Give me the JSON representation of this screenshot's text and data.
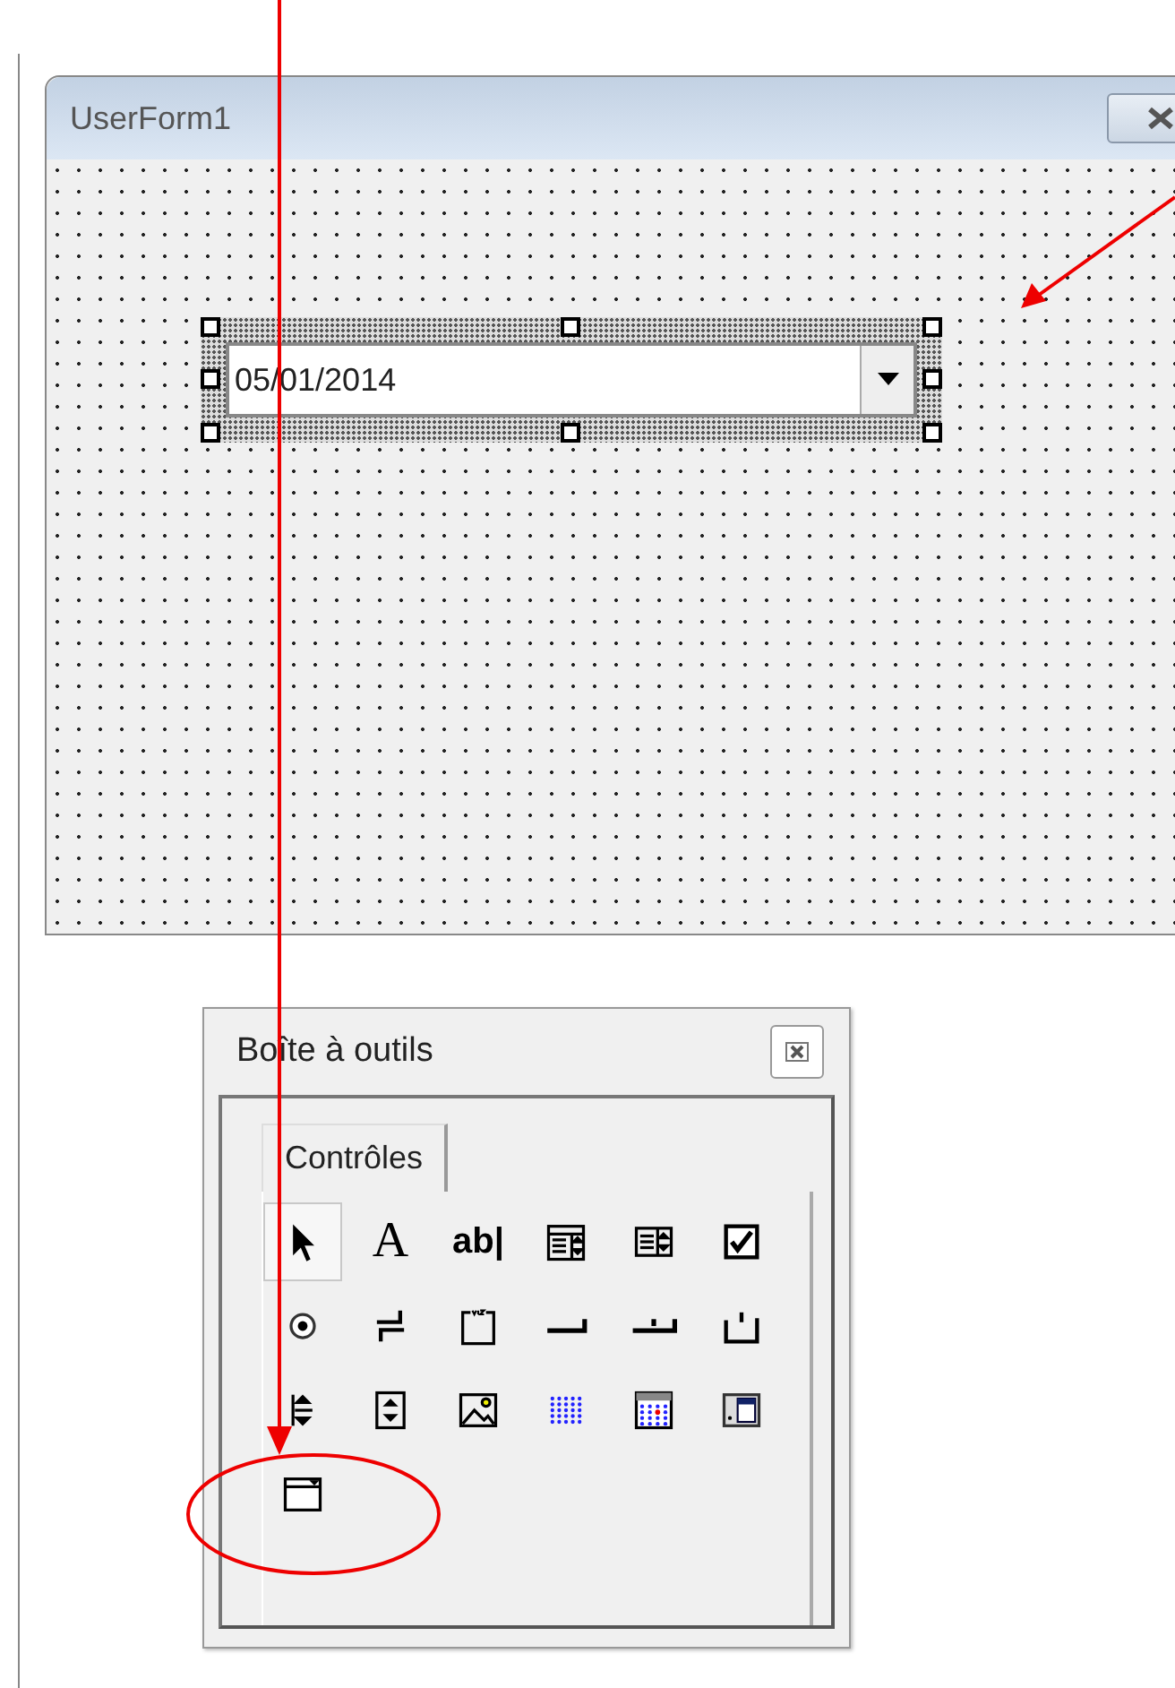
{
  "form": {
    "title": "UserForm1",
    "combo": {
      "value": "05/01/2014",
      "selected": true
    }
  },
  "toolbox": {
    "title": "Boîte à outils",
    "tabs": [
      {
        "label": "Contrôles",
        "selected": true
      }
    ],
    "tools": [
      {
        "kind": "pointer",
        "selected": true
      },
      {
        "kind": "label",
        "glyph": "A",
        "selected": false
      },
      {
        "kind": "textbox",
        "glyph": "ab|",
        "selected": false
      },
      {
        "kind": "combobox",
        "selected": false
      },
      {
        "kind": "listbox",
        "selected": false
      },
      {
        "kind": "checkbox",
        "selected": false
      },
      {
        "kind": "option",
        "selected": false
      },
      {
        "kind": "toggle",
        "selected": false
      },
      {
        "kind": "frame",
        "selected": false
      },
      {
        "kind": "command",
        "selected": false
      },
      {
        "kind": "tabstrip",
        "selected": false
      },
      {
        "kind": "multipage",
        "selected": false
      },
      {
        "kind": "scrollbar",
        "selected": false
      },
      {
        "kind": "spin",
        "selected": false
      },
      {
        "kind": "image",
        "selected": false
      },
      {
        "kind": "dotgrid",
        "selected": false
      },
      {
        "kind": "calendar",
        "selected": false
      },
      {
        "kind": "formpanel",
        "selected": false
      },
      {
        "kind": "dropdownpanel",
        "selected": false
      }
    ]
  }
}
